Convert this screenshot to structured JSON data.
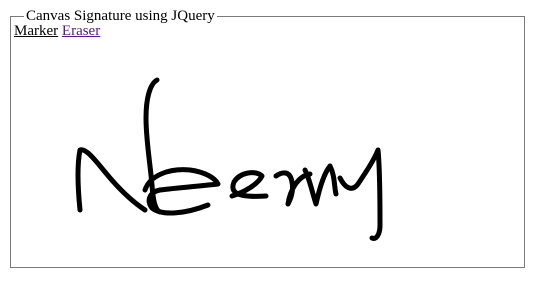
{
  "panel": {
    "legend": "Canvas Signature using JQuery"
  },
  "toolbar": {
    "marker_label": "Marker",
    "eraser_label": "Eraser"
  },
  "colors": {
    "ink": "#000000",
    "border": "#7a7a7a",
    "visited_link": "#551a8b"
  }
}
